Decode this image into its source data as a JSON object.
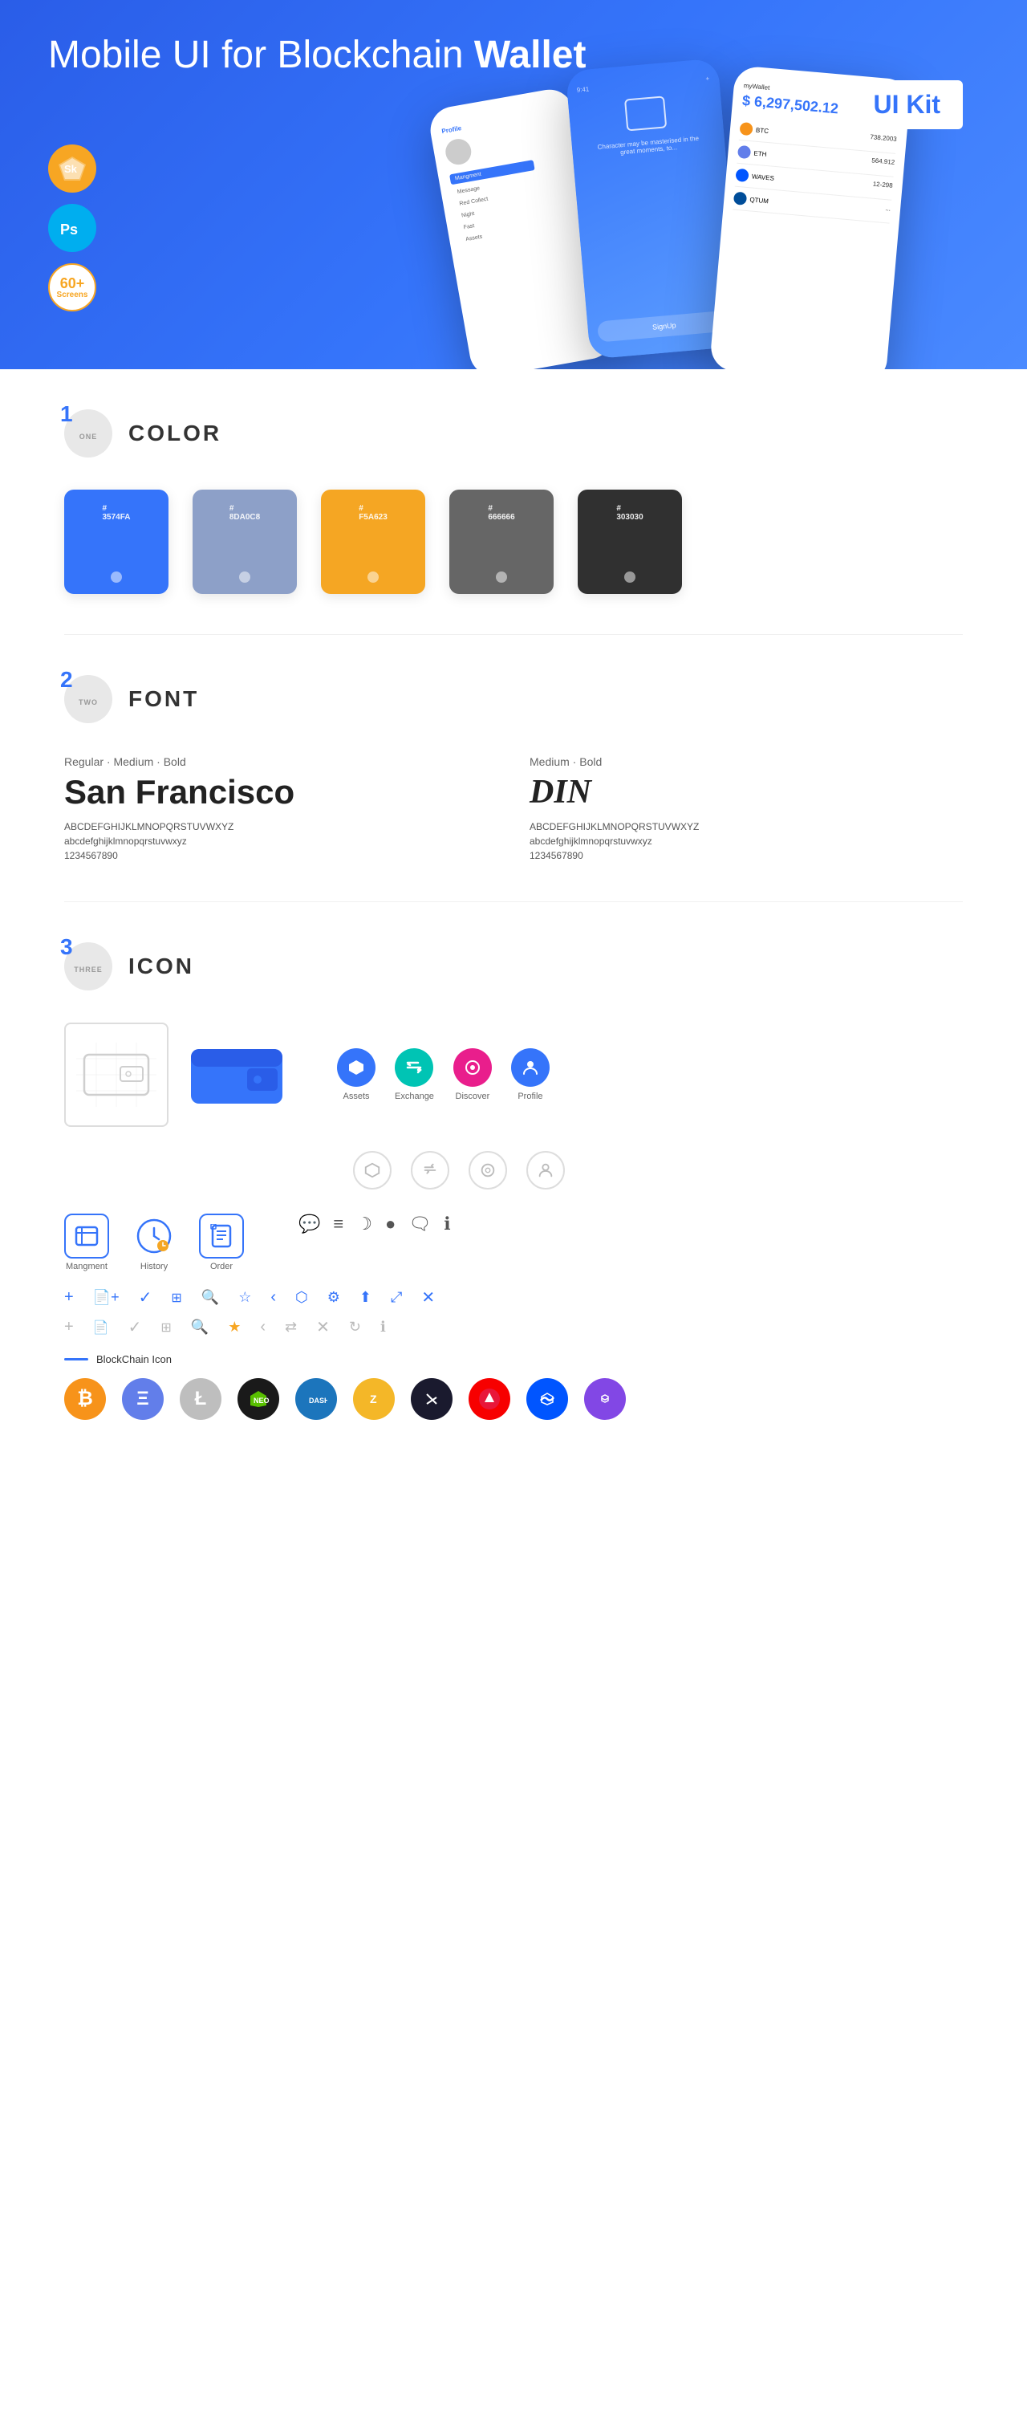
{
  "hero": {
    "title_part1": "Mobile UI for Blockchain ",
    "title_bold": "Wallet",
    "badge": "UI Kit",
    "badges": [
      {
        "label": "Sk",
        "type": "sketch"
      },
      {
        "label": "Ps",
        "type": "ps"
      },
      {
        "label": "60+\nScreens",
        "type": "screens"
      }
    ]
  },
  "sections": {
    "color": {
      "number": "1",
      "sub": "ONE",
      "title": "COLOR",
      "swatches": [
        {
          "hex": "#3574FA",
          "code": "#\n3574FA"
        },
        {
          "hex": "#8DA0C8",
          "code": "#\n8DA0C8"
        },
        {
          "hex": "#F5A623",
          "code": "#\nF5A623"
        },
        {
          "hex": "#666666",
          "code": "#\n666666"
        },
        {
          "hex": "#303030",
          "code": "#\n303030"
        }
      ]
    },
    "font": {
      "number": "2",
      "sub": "TWO",
      "title": "FONT",
      "fonts": [
        {
          "style": "Regular · Medium · Bold",
          "name": "San Francisco",
          "upper": "ABCDEFGHIJKLMNOPQRSTUVWXYZ",
          "lower": "abcdefghijklmnopqrstuvwxyz",
          "nums": "1234567890"
        },
        {
          "style": "Medium · Bold",
          "name": "DIN",
          "upper": "ABCDEFGHIJKLMNOPQRSTUVWXYZ",
          "lower": "abcdefghijklmnopqrstuvwxyz",
          "nums": "1234567890"
        }
      ]
    },
    "icon": {
      "number": "3",
      "sub": "THREE",
      "title": "ICON",
      "named_icons": [
        {
          "label": "Assets",
          "symbol": "◆"
        },
        {
          "label": "Exchange",
          "symbol": "⇄"
        },
        {
          "label": "Discover",
          "symbol": "●"
        },
        {
          "label": "Profile",
          "symbol": "👤"
        }
      ],
      "bottom_icons": [
        {
          "label": "Mangment",
          "symbol": "▣"
        },
        {
          "label": "History",
          "symbol": "🕐"
        },
        {
          "label": "Order",
          "symbol": "📋"
        }
      ],
      "blockchain_label": "BlockChain Icon",
      "crypto_icons": [
        {
          "symbol": "₿",
          "class": "btc"
        },
        {
          "symbol": "Ξ",
          "class": "eth"
        },
        {
          "symbol": "Ł",
          "class": "ltc"
        },
        {
          "symbol": "N",
          "class": "neo"
        },
        {
          "symbol": "D",
          "class": "dash"
        },
        {
          "symbol": "Z",
          "class": "zcash"
        },
        {
          "symbol": "◆",
          "class": "iota"
        },
        {
          "symbol": "Å",
          "class": "ark"
        },
        {
          "symbol": "W",
          "class": "waves"
        },
        {
          "symbol": "⬡",
          "class": "polygon"
        }
      ]
    }
  }
}
